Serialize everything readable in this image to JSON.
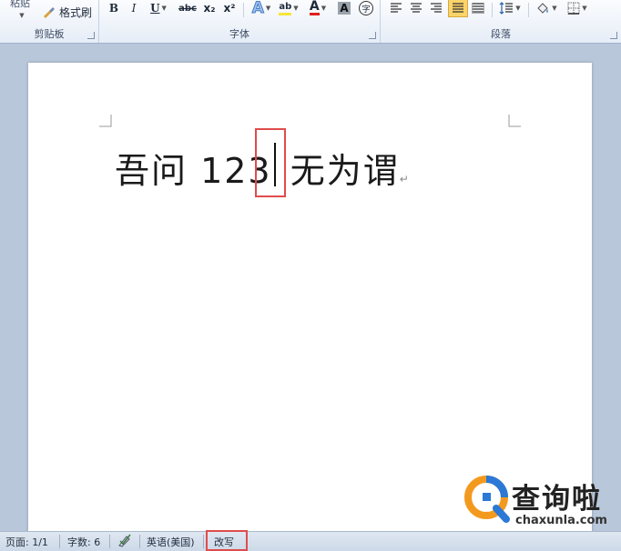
{
  "ribbon": {
    "clipboard": {
      "paste_label": "粘贴",
      "format_painter_label": "格式刷",
      "group_label": "剪贴板"
    },
    "font": {
      "bold": "B",
      "italic": "I",
      "underline": "U",
      "strikethrough": "abc",
      "subscript": "x₂",
      "superscript": "x²",
      "text_effect": "A",
      "highlight": "ab",
      "font_color": "A",
      "char_shading": "A",
      "enclose": "字",
      "group_label": "字体"
    },
    "paragraph": {
      "group_label": "段落"
    }
  },
  "document": {
    "text_before_caret": "吾问 123 ",
    "text_after_caret": "无为谓",
    "paragraph_mark": "↵"
  },
  "status_bar": {
    "page": "页面: 1/1",
    "word_count": "字数: 6",
    "language": "英语(美国)",
    "mode": "改写"
  },
  "watermark": {
    "title": "查询啦",
    "url": "chaxunla.com"
  },
  "colors": {
    "highlight_box": "#e04c4c",
    "watermark_orange": "#f39a1e",
    "watermark_blue": "#2b78d6"
  }
}
